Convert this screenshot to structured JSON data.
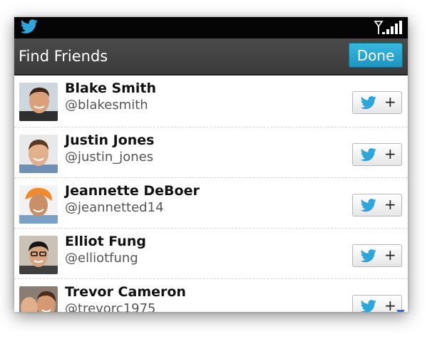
{
  "header": {
    "title": "Find Friends",
    "done_label": "Done"
  },
  "status_bar": {
    "app_icon": "twitter-bird-icon",
    "signal_icon": "signal-bars-icon"
  },
  "friends": [
    {
      "name": "Blake Smith",
      "handle": "@blakesmith",
      "follow_icon": "twitter-bird-icon",
      "plus": "+"
    },
    {
      "name": "Justin Jones",
      "handle": "@justin_jones",
      "follow_icon": "twitter-bird-icon",
      "plus": "+"
    },
    {
      "name": "Jeannette DeBoer",
      "handle": "@jeannetted14",
      "follow_icon": "twitter-bird-icon",
      "plus": "+"
    },
    {
      "name": "Elliot Fung",
      "handle": "@elliotfung",
      "follow_icon": "twitter-bird-icon",
      "plus": "+"
    },
    {
      "name": "Trevor Cameron",
      "handle": "@trevorc1975",
      "follow_icon": "twitter-bird-icon",
      "plus": "+"
    }
  ],
  "colors": {
    "accent": "#29a9d8",
    "title_bar": "#404040",
    "status_bar": "#050505"
  }
}
